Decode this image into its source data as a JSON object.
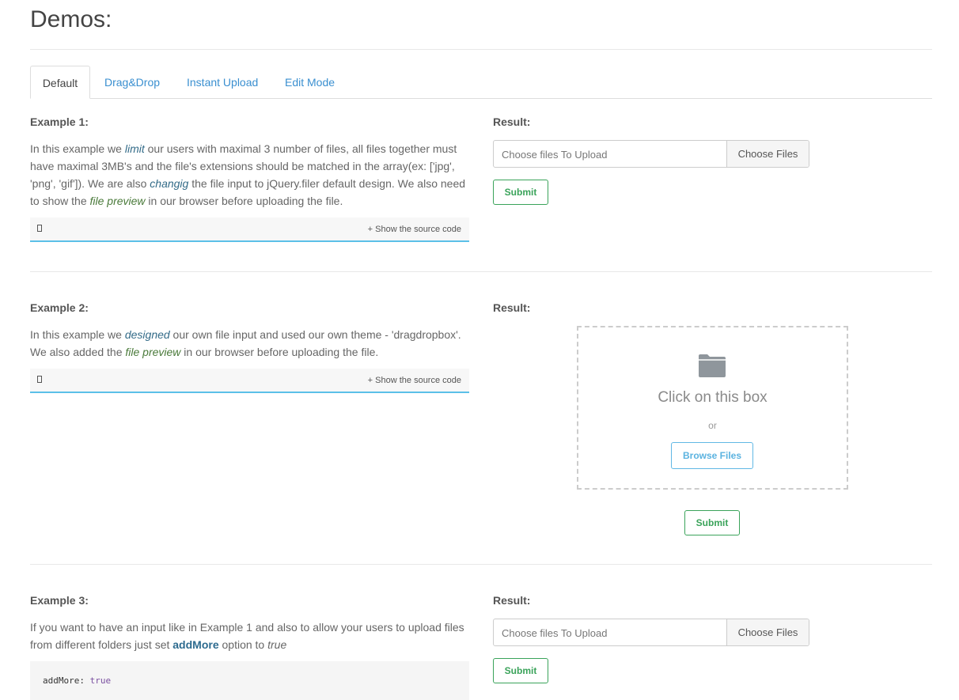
{
  "page": {
    "title": "Demos:"
  },
  "tabs": [
    {
      "label": "Default",
      "active": true
    },
    {
      "label": "Drag&Drop",
      "active": false
    },
    {
      "label": "Instant Upload",
      "active": false
    },
    {
      "label": "Edit Mode",
      "active": false
    }
  ],
  "example1": {
    "title": "Example 1:",
    "desc": {
      "t1": "In this example we ",
      "e1": "limit",
      "t2": " our users with maximal 3 number of files, all files together must have maximal 3MB's and the file's extensions should be matched in the array(ex: ['jpg', 'png', 'gif']). We are also ",
      "e2": "changig",
      "t3": " the file input to jQuery.filer default design. We also need to show the ",
      "e3": "file preview",
      "t4": " in our browser before uploading the file."
    },
    "show_source": "+ Show the source code",
    "result_label": "Result:",
    "input_placeholder": "Choose files To Upload",
    "choose_button": "Choose Files",
    "submit": "Submit"
  },
  "example2": {
    "title": "Example 2:",
    "desc": {
      "t1": "In this example we ",
      "e1": "designed",
      "t2": " our own file input and used our own theme - 'dragdropbox'. We also added the ",
      "e2": "file preview",
      "t3": " in our browser before uploading the file."
    },
    "show_source": "+ Show the source code",
    "result_label": "Result:",
    "drop_title": "Click on this box",
    "drop_or": "or",
    "browse_button": "Browse Files",
    "submit": "Submit"
  },
  "example3": {
    "title": "Example 3:",
    "desc": {
      "t1": "If you want to have an input like in Example 1 and also to allow your users to upload files from different folders just set ",
      "s1": "addMore",
      "t2": " option to ",
      "e1": "true"
    },
    "code_key": "addMore:",
    "code_val": "true",
    "result_label": "Result:",
    "input_placeholder": "Choose files To Upload",
    "choose_button": "Choose Files",
    "submit": "Submit"
  },
  "colors": {
    "accent_blue": "#5bc0e8",
    "submit_green": "#3aa35a",
    "tab_link": "#3a8fd0"
  },
  "icons": {
    "code_toggle": "square-glyph-icon",
    "dropbox": "folder-icon"
  }
}
